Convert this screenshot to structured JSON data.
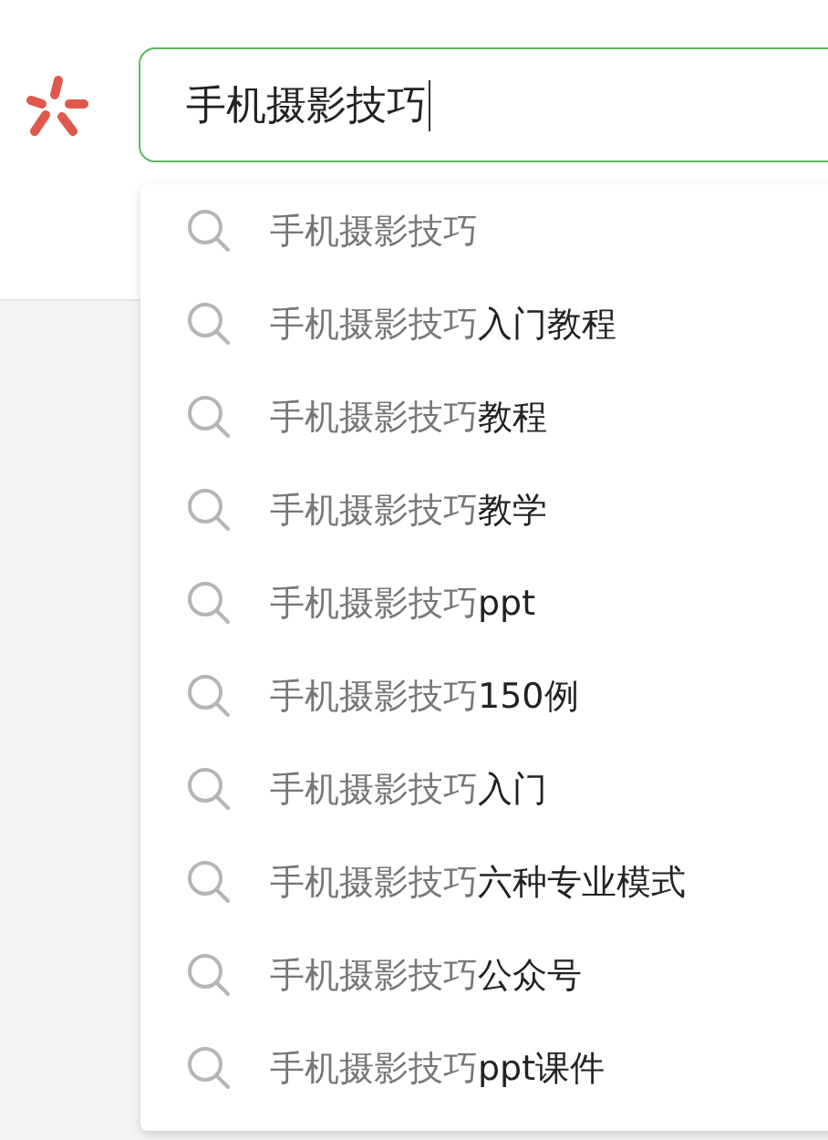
{
  "search": {
    "value": "手机摄影技巧"
  },
  "suggestions": [
    {
      "prefix": "手机摄影技巧"
    },
    {
      "prefix": "手机摄影技巧",
      "suffix": "入门教程"
    },
    {
      "prefix": "手机摄影技巧",
      "suffix": "教程"
    },
    {
      "prefix": "手机摄影技巧",
      "suffix": "教学"
    },
    {
      "prefix": "手机摄影技巧",
      "suffix": "ppt"
    },
    {
      "prefix": "手机摄影技巧",
      "suffix": "150例"
    },
    {
      "prefix": "手机摄影技巧",
      "suffix": "入门"
    },
    {
      "prefix": "手机摄影技巧",
      "suffix": "六种专业模式"
    },
    {
      "prefix": "手机摄影技巧",
      "suffix": "公众号"
    },
    {
      "prefix": "手机摄影技巧",
      "suffix": "ppt课件"
    }
  ]
}
